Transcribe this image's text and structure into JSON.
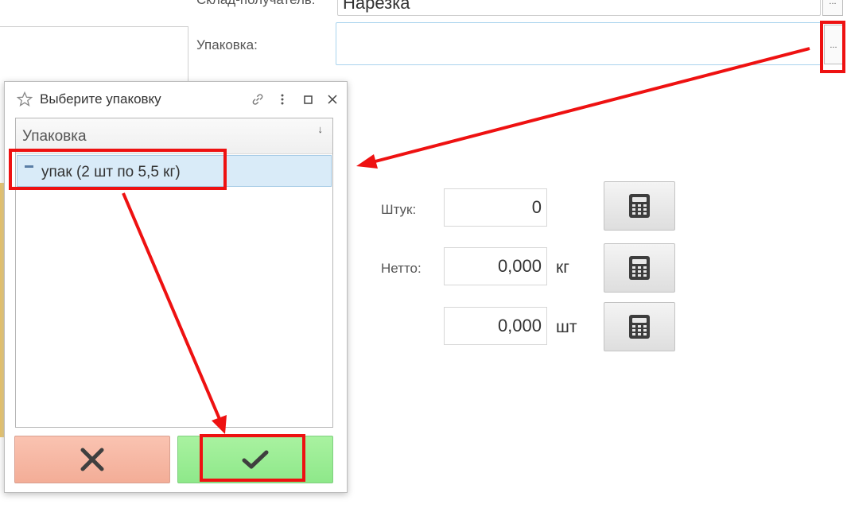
{
  "form": {
    "warehouse_label": "Склад-получатель:",
    "warehouse_value": "Нарезка",
    "warehouse_select": "...",
    "package_label": "Упаковка:",
    "package_value": "",
    "package_select": "..."
  },
  "quantity": {
    "pieces_label": "Штук:",
    "pieces_value": "0",
    "net_label": "Нетто:",
    "net_value": "0,000",
    "net_unit": "кг",
    "extra_value": "0,000",
    "extra_unit": "шт"
  },
  "dialog": {
    "title": "Выберите упаковку",
    "column_header": "Упаковка",
    "sort_indicator": "↓",
    "rows": [
      {
        "label": "упак (2 шт по 5,5 кг)"
      }
    ],
    "icons": [
      "star-icon",
      "link-icon",
      "more-icon",
      "maximize-icon",
      "close-icon"
    ]
  },
  "colors": {
    "highlight": "#ee1111",
    "cancel": "#f6b7a3",
    "ok": "#97ee92",
    "selected_row": "#d9ebf8"
  }
}
